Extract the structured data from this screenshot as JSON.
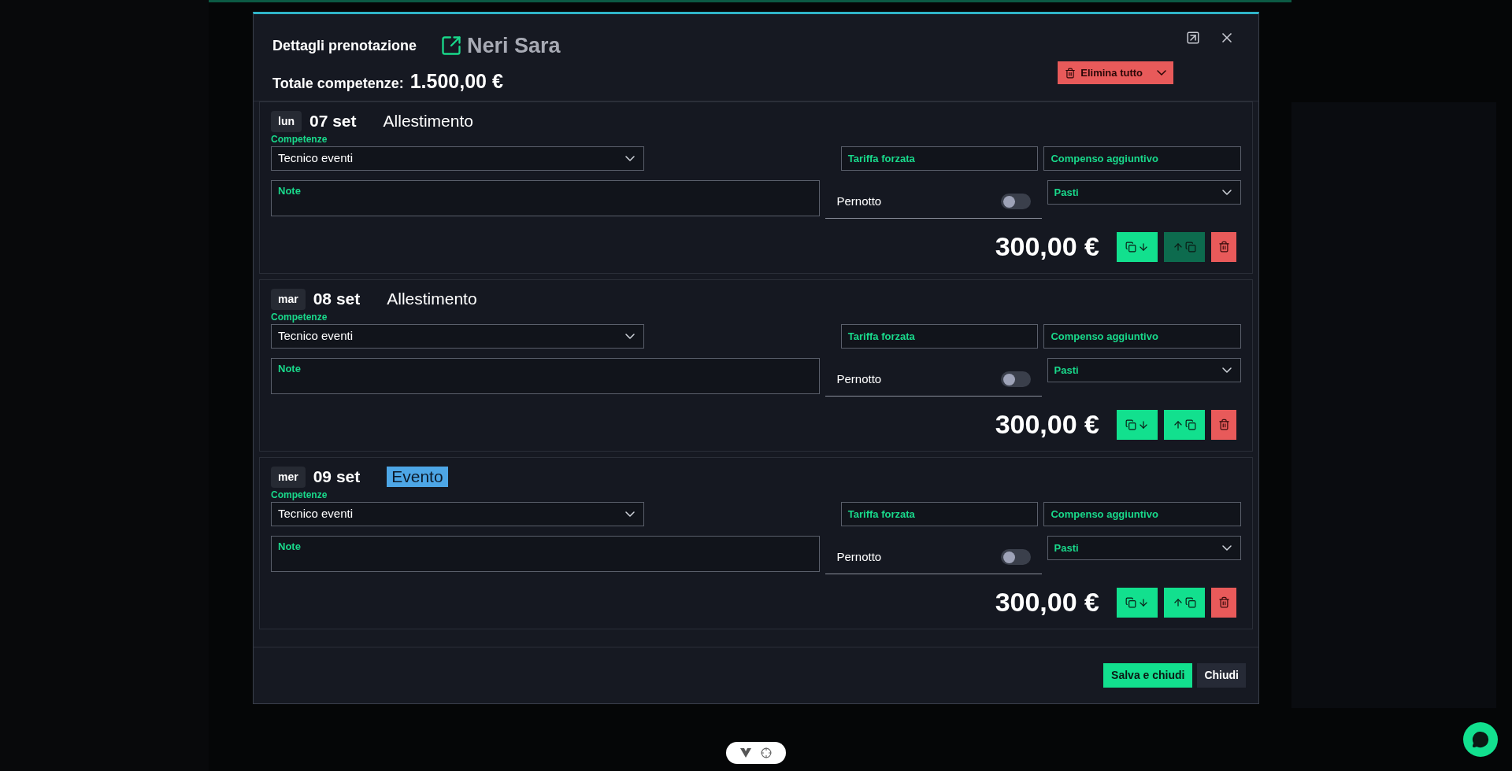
{
  "modal": {
    "title": "Dettagli prenotazione",
    "person": "Neri Sara",
    "total_label": "Totale competenze:",
    "total": "1.500,00 €",
    "delete_all": "Elimina tutto"
  },
  "days": [
    {
      "weekday": "lun",
      "date": "07 set",
      "phase": "Allestimento",
      "highlight": false,
      "skills_label": "Competenze",
      "skill": "Tecnico eventi",
      "rate_label": "Tariffa forzata",
      "extra_label": "Compenso aggiuntivo",
      "notes_label": "Note",
      "overnight_label": "Pernotto",
      "overnight_on": false,
      "meals_label": "Pasti",
      "amount": "300,00 €",
      "copy_up_disabled": true
    },
    {
      "weekday": "mar",
      "date": "08 set",
      "phase": "Allestimento",
      "highlight": false,
      "skills_label": "Competenze",
      "skill": "Tecnico eventi",
      "rate_label": "Tariffa forzata",
      "extra_label": "Compenso aggiuntivo",
      "notes_label": "Note",
      "overnight_label": "Pernotto",
      "overnight_on": false,
      "meals_label": "Pasti",
      "amount": "300,00 €",
      "copy_up_disabled": false
    },
    {
      "weekday": "mer",
      "date": "09 set",
      "phase": "Evento",
      "highlight": true,
      "skills_label": "Competenze",
      "skill": "Tecnico eventi",
      "rate_label": "Tariffa forzata",
      "extra_label": "Compenso aggiuntivo",
      "notes_label": "Note",
      "overnight_label": "Pernotto",
      "overnight_on": false,
      "meals_label": "Pasti",
      "amount": "300,00 €",
      "copy_up_disabled": false
    }
  ],
  "footer": {
    "save": "Salva e chiudi",
    "close": "Chiudi"
  }
}
